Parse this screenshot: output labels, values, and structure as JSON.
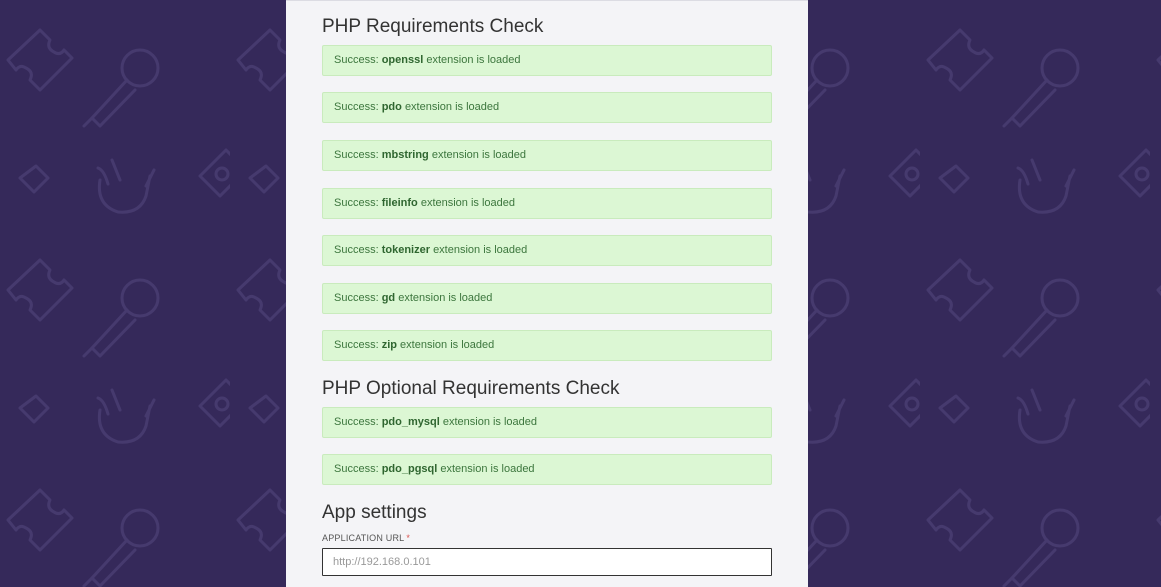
{
  "requirements": {
    "title": "PHP Requirements Check",
    "items": [
      {
        "prefix": "Success:",
        "ext": "openssl",
        "suffix": "extension is loaded"
      },
      {
        "prefix": "Success:",
        "ext": "pdo",
        "suffix": "extension is loaded"
      },
      {
        "prefix": "Success:",
        "ext": "mbstring",
        "suffix": "extension is loaded"
      },
      {
        "prefix": "Success:",
        "ext": "fileinfo",
        "suffix": "extension is loaded"
      },
      {
        "prefix": "Success:",
        "ext": "tokenizer",
        "suffix": "extension is loaded"
      },
      {
        "prefix": "Success:",
        "ext": "gd",
        "suffix": "extension is loaded"
      },
      {
        "prefix": "Success:",
        "ext": "zip",
        "suffix": "extension is loaded"
      }
    ]
  },
  "optional": {
    "title": "PHP Optional Requirements Check",
    "items": [
      {
        "prefix": "Success:",
        "ext": "pdo_mysql",
        "suffix": "extension is loaded"
      },
      {
        "prefix": "Success:",
        "ext": "pdo_pgsql",
        "suffix": "extension is loaded"
      }
    ]
  },
  "app_settings": {
    "title": "App settings",
    "url_label": "APPLICATION URL",
    "url_required_mark": "*",
    "url_placeholder": "http://192.168.0.101",
    "url_value": ""
  },
  "colors": {
    "background": "#35295a",
    "panel": "#f4f4f7",
    "success_bg": "#dcf7d4",
    "success_text": "#3c763d"
  }
}
